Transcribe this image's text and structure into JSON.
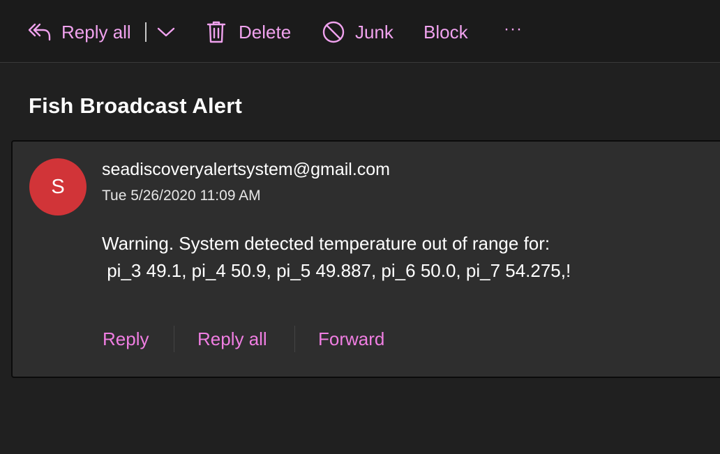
{
  "toolbar": {
    "reply_all_label": "Reply all",
    "delete_label": "Delete",
    "junk_label": "Junk",
    "block_label": "Block",
    "more_label": "···"
  },
  "message": {
    "subject": "Fish Broadcast Alert",
    "avatar_initial": "S",
    "sender": "seadiscoveryalertsystem@gmail.com",
    "date": "Tue 5/26/2020 11:09 AM",
    "body_line1": "Warning. System detected temperature out of range for:",
    "body_line2": " pi_3 49.1, pi_4 50.9, pi_5 49.887, pi_6 50.0, pi_7 54.275,!"
  },
  "actions": {
    "reply_label": "Reply",
    "reply_all_label": "Reply all",
    "forward_label": "Forward"
  },
  "colors": {
    "accent": "#f0a2ee",
    "action": "#f07ee2",
    "avatar": "#d13438",
    "background": "#202020",
    "card": "#2e2e2e"
  },
  "icons": [
    "reply-all-icon",
    "chevron-down-icon",
    "trash-icon",
    "block-circle-icon",
    "more-icon"
  ]
}
